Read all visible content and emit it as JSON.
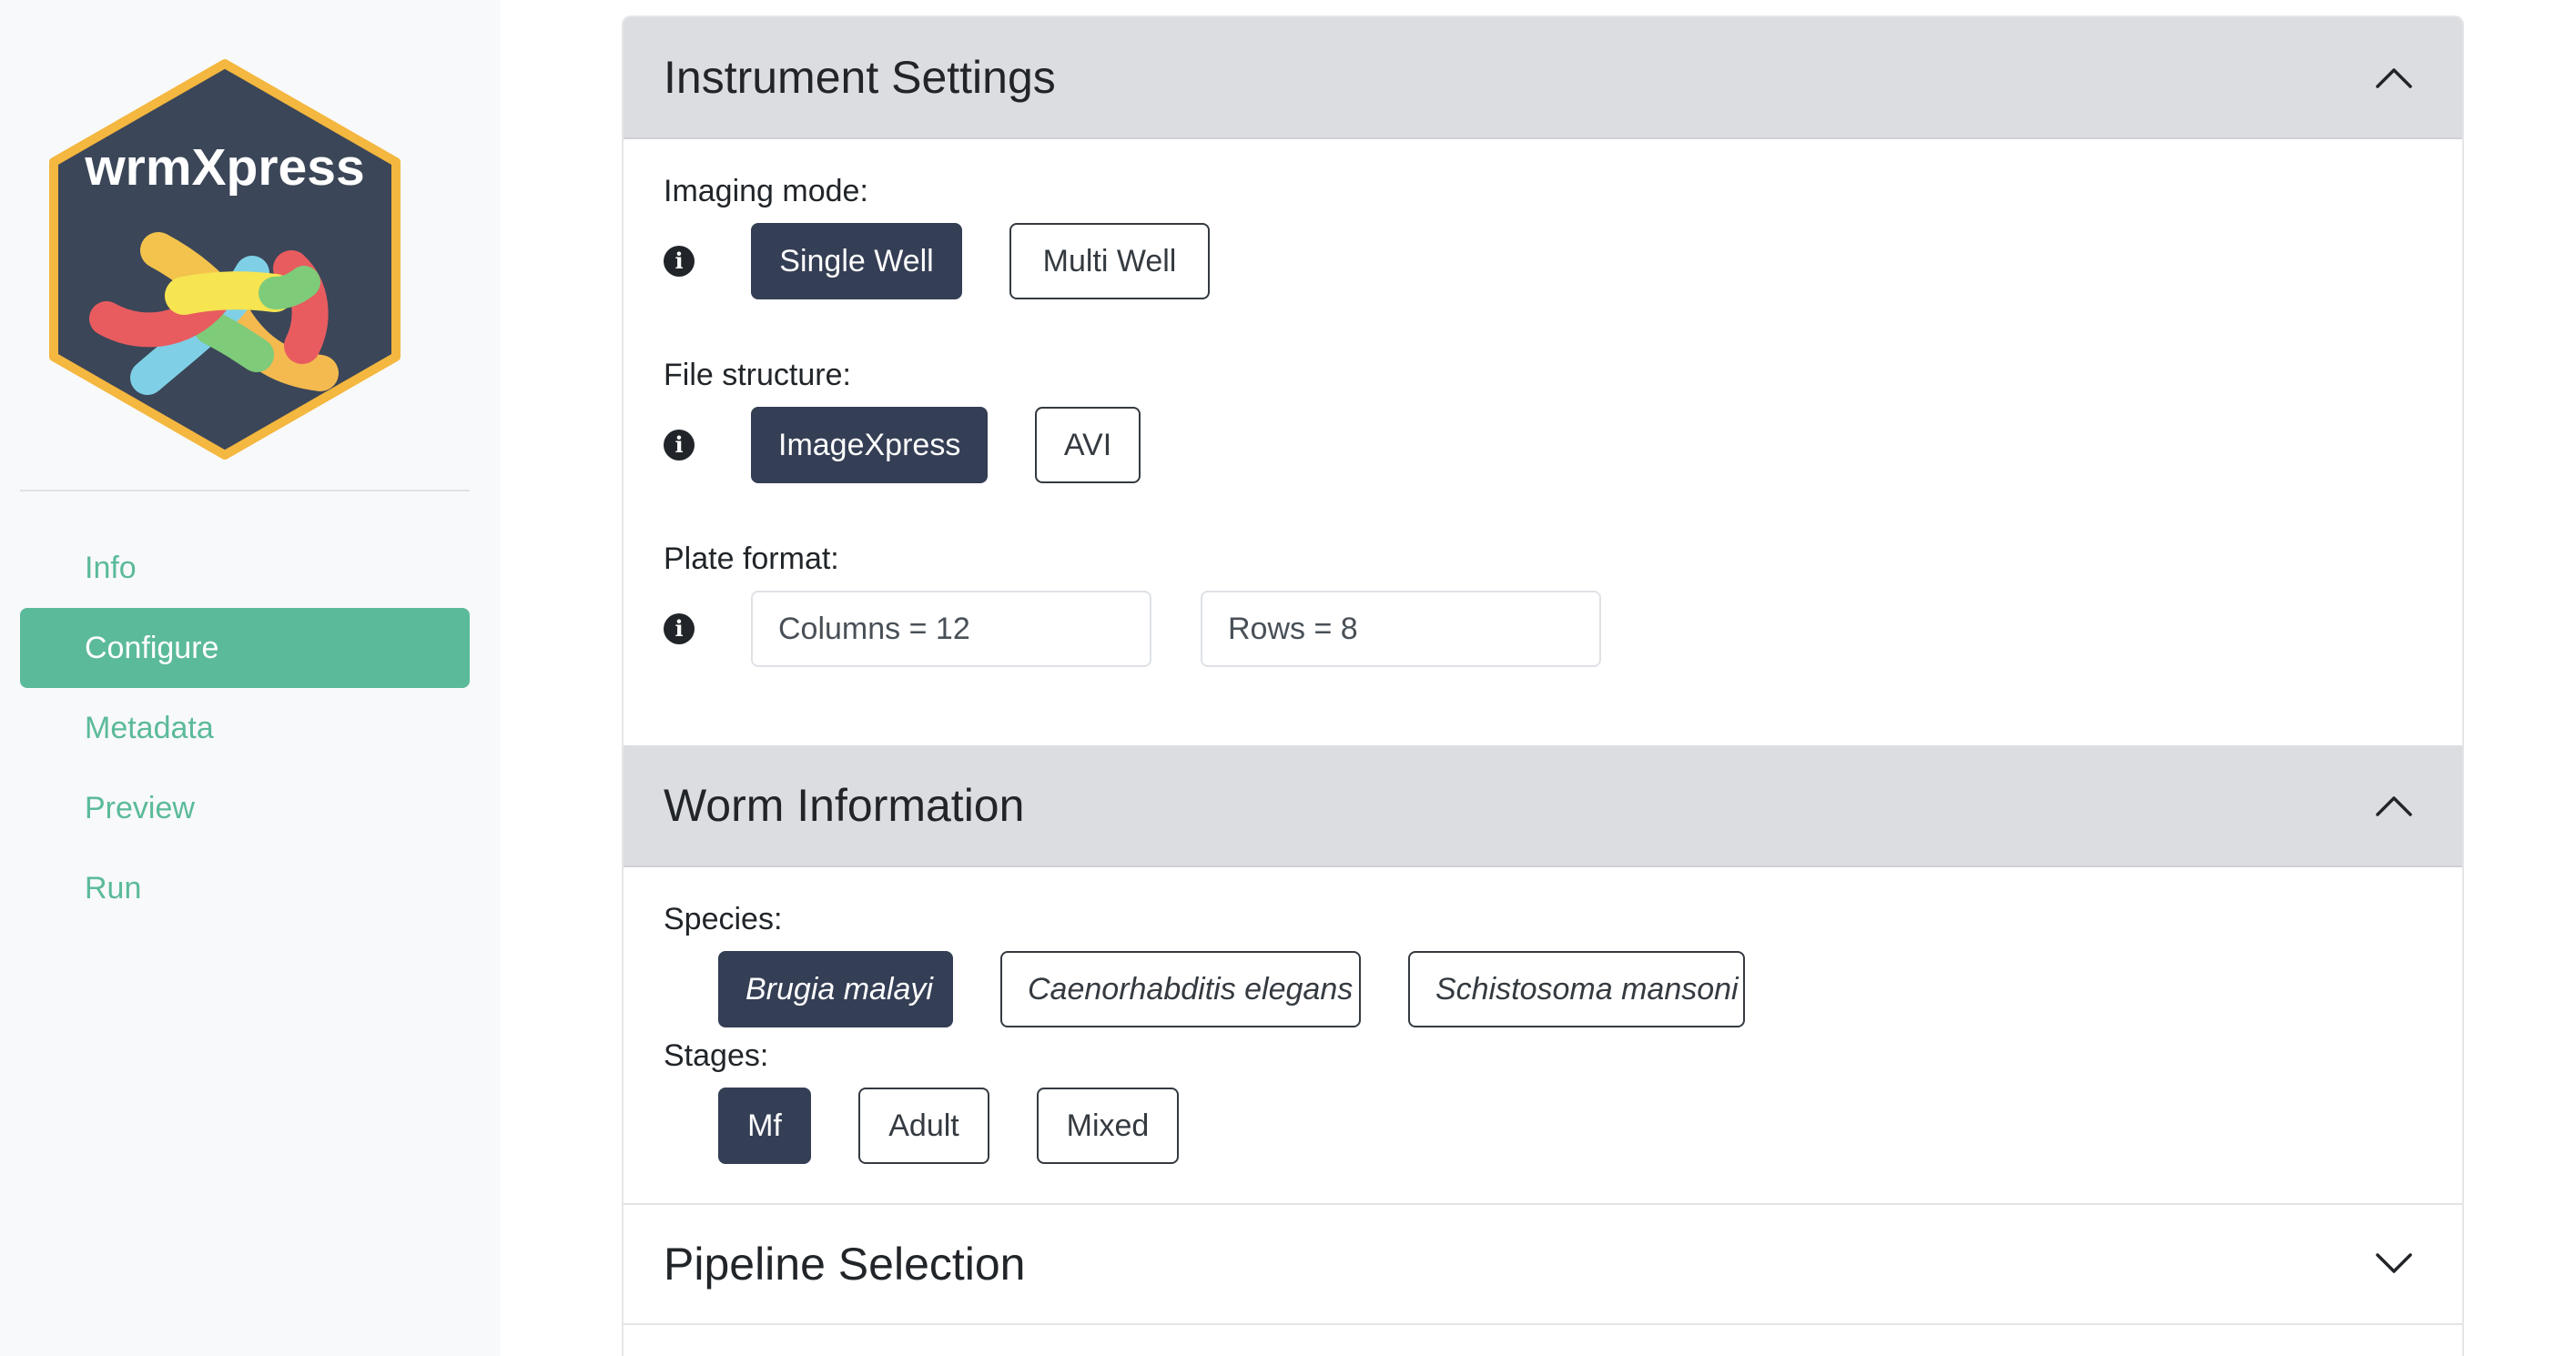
{
  "sidebar": {
    "logo_text": "wrmXpress",
    "nav": [
      {
        "label": "Info",
        "active": false
      },
      {
        "label": "Configure",
        "active": true
      },
      {
        "label": "Metadata",
        "active": false
      },
      {
        "label": "Preview",
        "active": false
      },
      {
        "label": "Run",
        "active": false
      }
    ]
  },
  "colors": {
    "accent": "#5bba9a",
    "selected_button": "#343e55",
    "logo_hex_fill": "#3b4658",
    "logo_hex_border": "#f4b73f",
    "section_header": "#dcdde1"
  },
  "instrument_settings": {
    "title": "Instrument Settings",
    "expanded": true,
    "imaging_mode": {
      "label": "Imaging mode:",
      "options": [
        "Single Well",
        "Multi Well"
      ],
      "selected": "Single Well"
    },
    "file_structure": {
      "label": "File structure:",
      "options": [
        "ImageXpress",
        "AVI"
      ],
      "selected": "ImageXpress"
    },
    "plate_format": {
      "label": "Plate format:",
      "columns_value": "Columns = 12",
      "rows_value": "Rows = 8"
    }
  },
  "worm_information": {
    "title": "Worm Information",
    "expanded": true,
    "species": {
      "label": "Species:",
      "options": [
        "Brugia malayi",
        "Caenorhabditis elegans",
        "Schistosoma mansoni"
      ],
      "selected": "Brugia malayi"
    },
    "stages": {
      "label": "Stages:",
      "options": [
        "Mf",
        "Adult",
        "Mixed"
      ],
      "selected": "Mf"
    }
  },
  "pipeline_selection": {
    "title": "Pipeline Selection",
    "expanded": false
  },
  "icons": {
    "info": "info-icon",
    "chevron_up": "chevron-up-icon",
    "chevron_down": "chevron-down-icon"
  }
}
